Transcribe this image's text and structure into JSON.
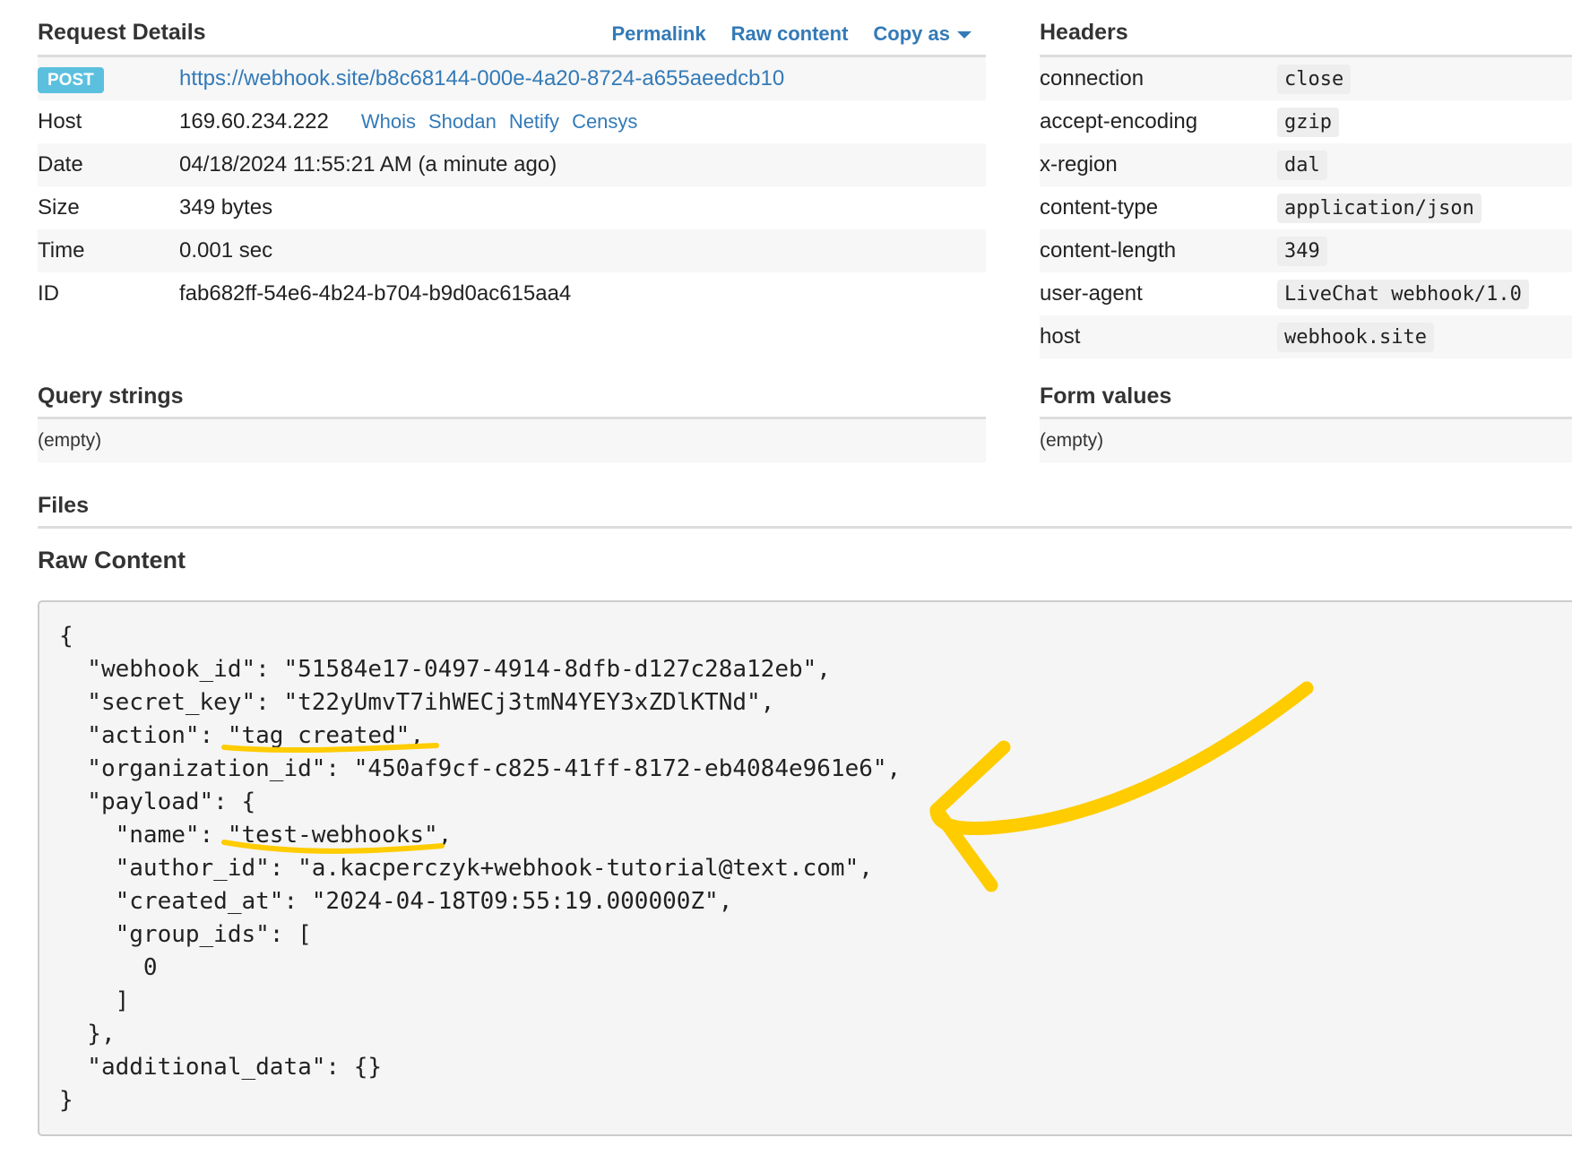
{
  "request_details": {
    "title": "Request Details",
    "links": {
      "permalink": "Permalink",
      "raw_content": "Raw content",
      "copy_as": "Copy as"
    },
    "method": "POST",
    "url": "https://webhook.site/b8c68144-000e-4a20-8724-a655aeedcb10",
    "rows": [
      {
        "key": "Host",
        "value": "169.60.234.222"
      },
      {
        "key": "Date",
        "value": "04/18/2024 11:55:21 AM (a minute ago)"
      },
      {
        "key": "Size",
        "value": "349 bytes"
      },
      {
        "key": "Time",
        "value": "0.001 sec"
      },
      {
        "key": "ID",
        "value": "fab682ff-54e6-4b24-b704-b9d0ac615aa4"
      }
    ],
    "host_lookup": [
      "Whois",
      "Shodan",
      "Netify",
      "Censys"
    ]
  },
  "headers": {
    "title": "Headers",
    "rows": [
      {
        "key": "connection",
        "value": "close"
      },
      {
        "key": "accept-encoding",
        "value": "gzip"
      },
      {
        "key": "x-region",
        "value": "dal"
      },
      {
        "key": "content-type",
        "value": "application/json"
      },
      {
        "key": "content-length",
        "value": "349"
      },
      {
        "key": "user-agent",
        "value": "LiveChat webhook/1.0"
      },
      {
        "key": "host",
        "value": "webhook.site"
      }
    ]
  },
  "query_strings": {
    "title": "Query strings",
    "value": "(empty)"
  },
  "form_values": {
    "title": "Form values",
    "value": "(empty)"
  },
  "files": {
    "title": "Files"
  },
  "raw_content": {
    "title": "Raw Content",
    "body": "{\n  \"webhook_id\": \"51584e17-0497-4914-8dfb-d127c28a12eb\",\n  \"secret_key\": \"t22yUmvT7ihWECj3tmN4YEY3xZDlKTNd\",\n  \"action\": \"tag_created\",\n  \"organization_id\": \"450af9cf-c825-41ff-8172-eb4084e961e6\",\n  \"payload\": {\n    \"name\": \"test-webhooks\",\n    \"author_id\": \"a.kacperczyk+webhook-tutorial@text.com\",\n    \"created_at\": \"2024-04-18T09:55:19.000000Z\",\n    \"group_ids\": [\n      0\n    ]\n  },\n  \"additional_data\": {}\n}"
  },
  "annotation": {
    "color": "#ffcc00"
  }
}
